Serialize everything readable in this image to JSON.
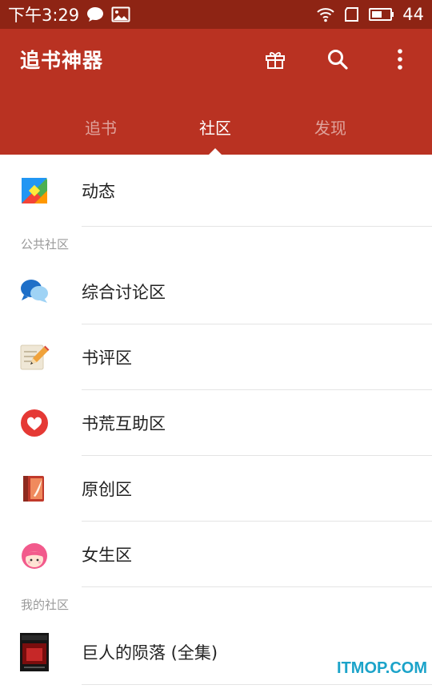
{
  "status_bar": {
    "time": "下午3:29",
    "battery": "44",
    "icons": [
      "chat-bubble-icon",
      "image-icon",
      "wifi-icon",
      "sim-icon",
      "battery-icon"
    ]
  },
  "app_bar": {
    "title": "追书神器",
    "background": "#b93222",
    "actions": [
      "gift-icon",
      "search-icon",
      "more-vert-icon"
    ]
  },
  "tabs": [
    {
      "label": "追书",
      "active": false
    },
    {
      "label": "社区",
      "active": true
    },
    {
      "label": "发现",
      "active": false
    }
  ],
  "list": {
    "feed_item": {
      "label": "动态",
      "icon": "feed-tiles-icon"
    },
    "public_section": {
      "header": "公共社区",
      "items": [
        {
          "label": "综合讨论区",
          "icon": "discussion-bubbles-icon"
        },
        {
          "label": "书评区",
          "icon": "review-pencil-icon"
        },
        {
          "label": "书荒互助区",
          "icon": "heart-icon"
        },
        {
          "label": "原创区",
          "icon": "original-book-icon"
        },
        {
          "label": "女生区",
          "icon": "girl-face-icon"
        }
      ]
    },
    "my_section": {
      "header": "我的社区",
      "items": [
        {
          "label": "巨人的陨落 (全集)",
          "icon": "book-cover-icon",
          "cover_text": "巨人的陨落"
        }
      ]
    }
  },
  "watermark": "ITMOP.COM"
}
